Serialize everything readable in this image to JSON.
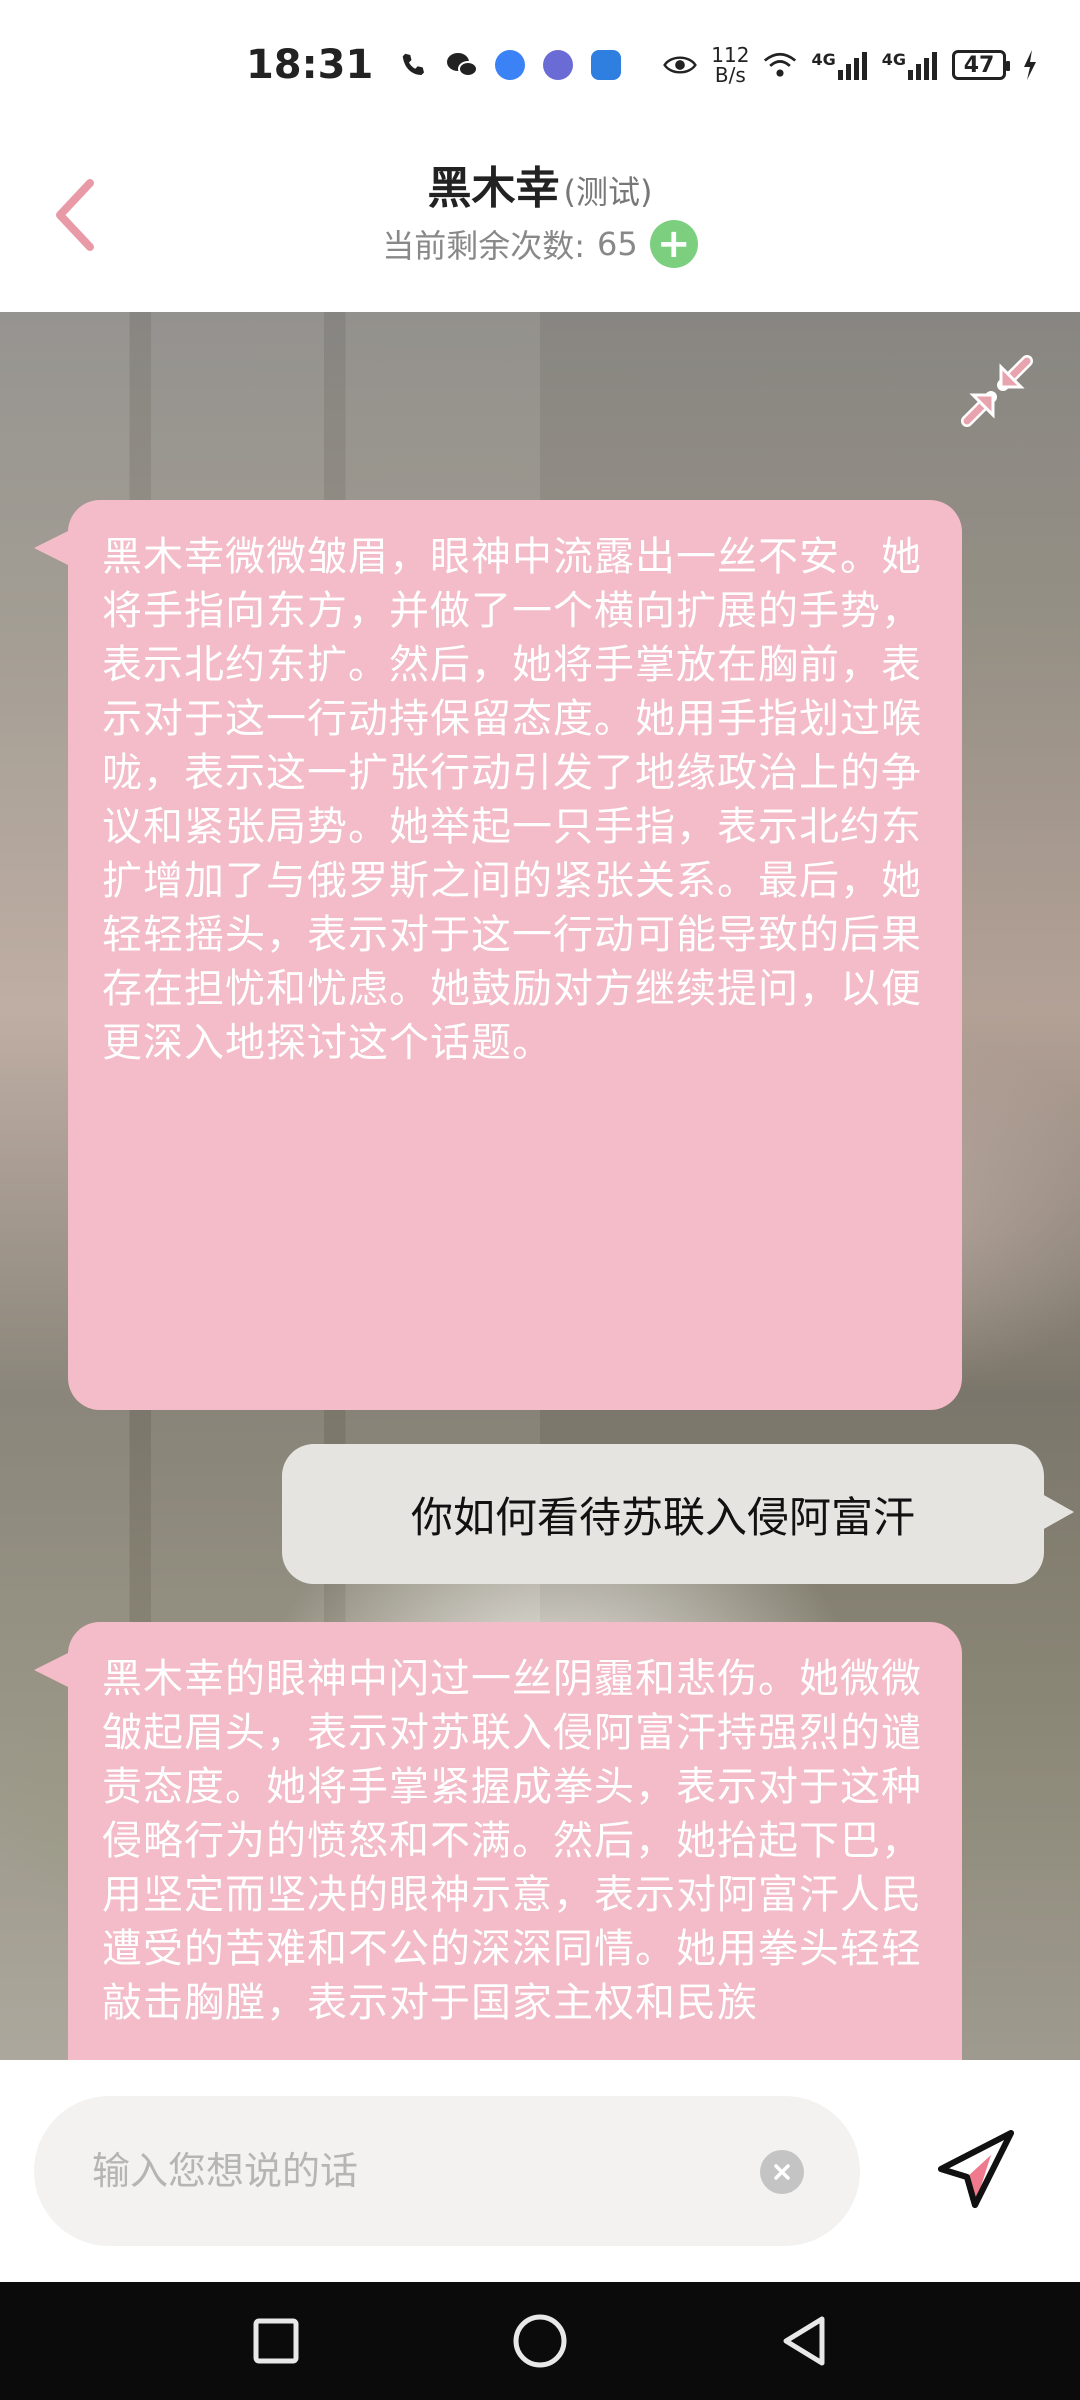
{
  "status_bar": {
    "time": "18:31",
    "net_speed_value": "112",
    "net_speed_unit": "B/s",
    "signal1": "4G",
    "signal2": "4G",
    "battery": "47"
  },
  "header": {
    "name": "黑木幸",
    "tag": "(测试)",
    "remaining_label": "当前剩余次数:",
    "remaining_count": "65",
    "plus": "+"
  },
  "messages": [
    {
      "role": "ai",
      "text": "黑木幸微微皱眉，眼神中流露出一丝不安。她将手指向东方，并做了一个横向扩展的手势，表示北约东扩。然后，她将手掌放在胸前，表示对于这一行动持保留态度。她用手指划过喉咙，表示这一扩张行动引发了地缘政治上的争议和紧张局势。她举起一只手指，表示北约东扩增加了与俄罗斯之间的紧张关系。最后，她轻轻摇头，表示对于这一行动可能导致的后果存在担忧和忧虑。她鼓励对方继续提问，以便更深入地探讨这个话题。"
    },
    {
      "role": "user",
      "text": "你如何看待苏联入侵阿富汗"
    },
    {
      "role": "ai",
      "text": "黑木幸的眼神中闪过一丝阴霾和悲伤。她微微皱起眉头，表示对苏联入侵阿富汗持强烈的谴责态度。她将手掌紧握成拳头，表示对于这种侵略行为的愤怒和不满。然后，她抬起下巴，用坚定而坚决的眼神示意，表示对阿富汗人民遭受的苦难和不公的深深同情。她用拳头轻轻敲击胸膛，表示对于国家主权和民族"
    }
  ],
  "input": {
    "placeholder": "输入您想说的话",
    "value": ""
  },
  "colors": {
    "accent_pink": "#f4bcc8",
    "back_arrow": "#e89aa6",
    "plus_green": "#7ccf7f"
  },
  "icons": {
    "back": "chevron-left-icon",
    "collapse": "collapse-icon",
    "send": "send-icon",
    "clear": "clear-icon",
    "nav_recent": "square-icon",
    "nav_home": "circle-icon",
    "nav_back": "triangle-back-icon"
  }
}
